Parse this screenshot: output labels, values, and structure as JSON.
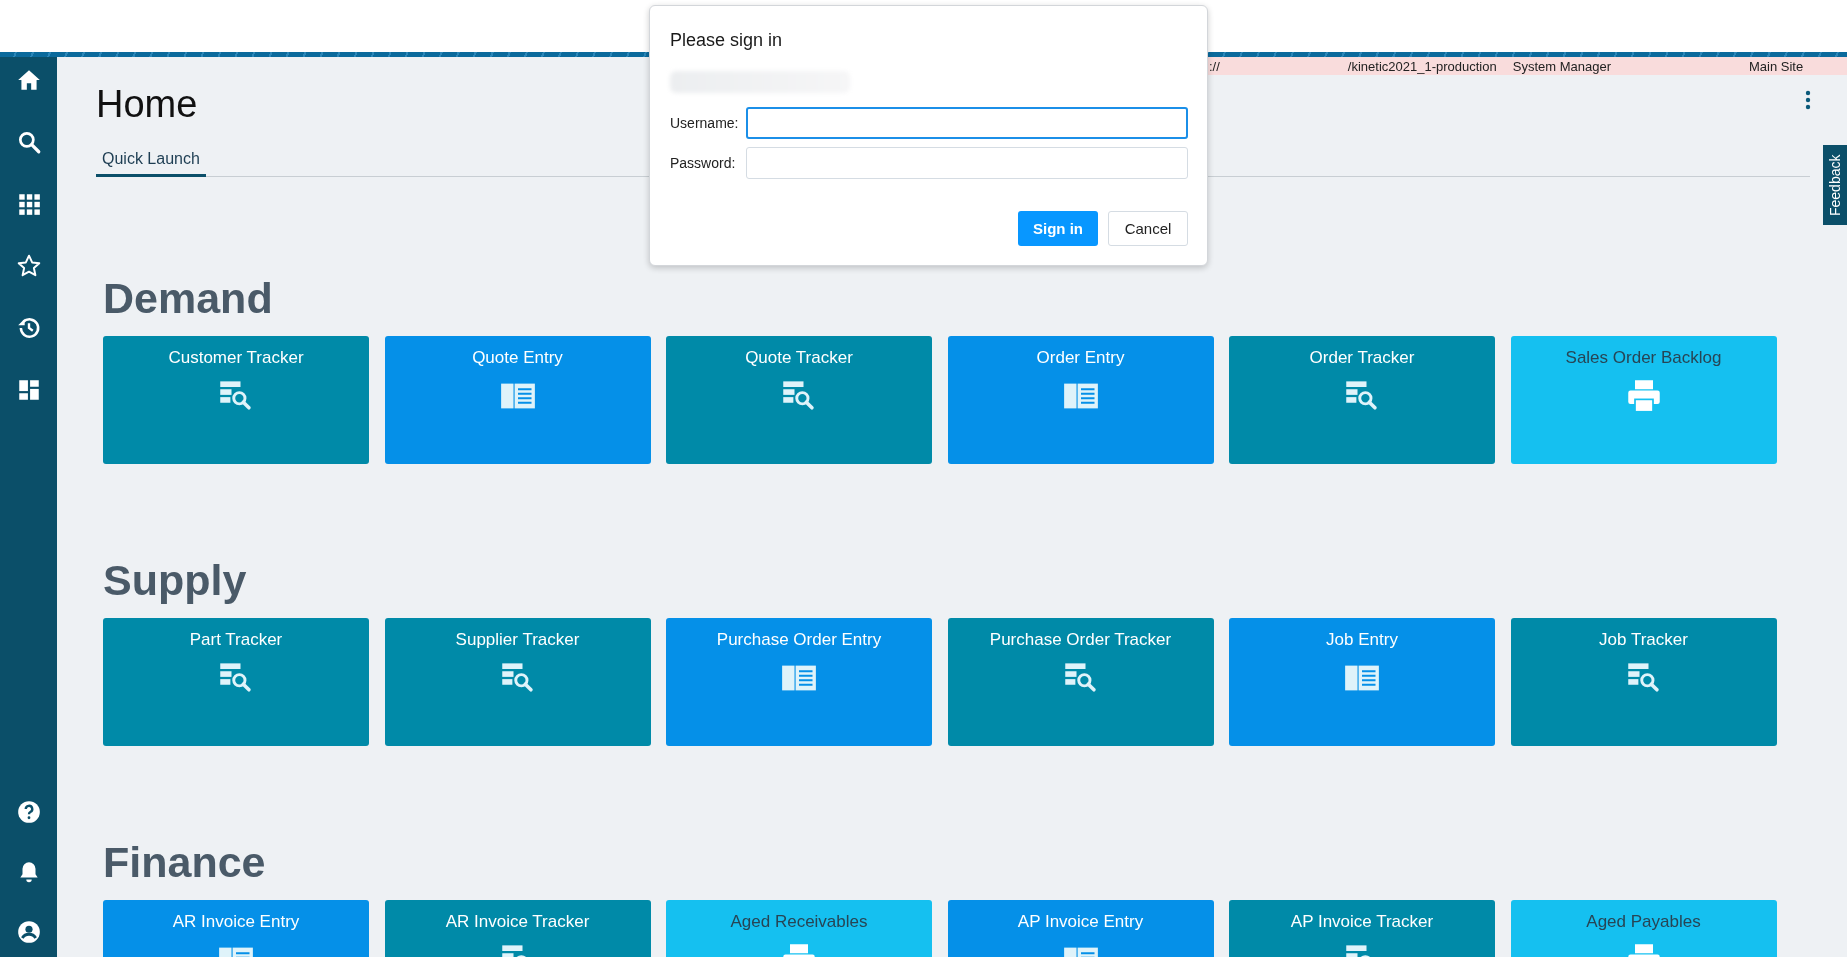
{
  "environment_bar": {
    "texts": [
      "://",
      "/kinetic2021_1-production",
      "System Manager",
      "Main Site"
    ]
  },
  "sidebar": {
    "top_items": [
      {
        "kind": "home"
      },
      {
        "kind": "search"
      },
      {
        "kind": "apps"
      },
      {
        "kind": "favorites"
      },
      {
        "kind": "history"
      },
      {
        "kind": "dashboard"
      }
    ],
    "bottom_items": [
      {
        "kind": "help"
      },
      {
        "kind": "notifications"
      },
      {
        "kind": "account"
      }
    ]
  },
  "page": {
    "title": "Home",
    "tabs": [
      {
        "label": "Quick Launch",
        "selected": true
      }
    ],
    "feedback": "Feedback"
  },
  "sections": [
    {
      "title": "Demand",
      "tiles": [
        {
          "label": "Customer Tracker",
          "kind": "tracker"
        },
        {
          "label": "Quote Entry",
          "kind": "entry"
        },
        {
          "label": "Quote Tracker",
          "kind": "tracker"
        },
        {
          "label": "Order Entry",
          "kind": "entry"
        },
        {
          "label": "Order Tracker",
          "kind": "tracker"
        },
        {
          "label": "Sales Order Backlog",
          "kind": "report"
        }
      ]
    },
    {
      "title": "Supply",
      "tiles": [
        {
          "label": "Part Tracker",
          "kind": "tracker"
        },
        {
          "label": "Supplier Tracker",
          "kind": "tracker"
        },
        {
          "label": "Purchase Order Entry",
          "kind": "entry"
        },
        {
          "label": "Purchase Order Tracker",
          "kind": "tracker"
        },
        {
          "label": "Job Entry",
          "kind": "entry"
        },
        {
          "label": "Job Tracker",
          "kind": "tracker"
        }
      ]
    },
    {
      "title": "Finance",
      "tiles": [
        {
          "label": "AR Invoice Entry",
          "kind": "entry"
        },
        {
          "label": "AR Invoice Tracker",
          "kind": "tracker"
        },
        {
          "label": "Aged Receivables",
          "kind": "report"
        },
        {
          "label": "AP Invoice Entry",
          "kind": "entry"
        },
        {
          "label": "AP Invoice Tracker",
          "kind": "tracker"
        },
        {
          "label": "Aged Payables",
          "kind": "report"
        }
      ]
    }
  ],
  "dialog": {
    "title": "Please sign in",
    "fields": [
      {
        "label": "Username:",
        "focused": true
      },
      {
        "label": "Password:",
        "focused": false
      }
    ],
    "buttons": [
      {
        "label": "Sign in",
        "kind": "primary"
      },
      {
        "label": "Cancel",
        "kind": "secondary"
      }
    ]
  }
}
